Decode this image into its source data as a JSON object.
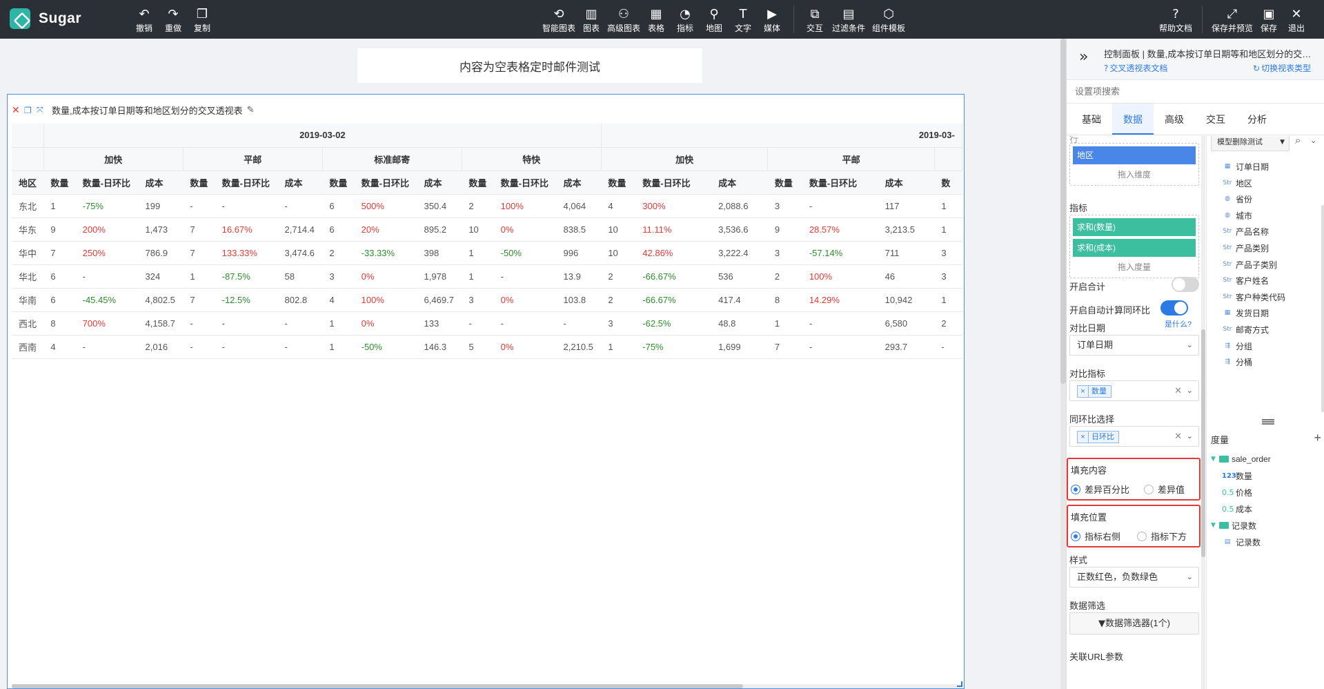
{
  "app": {
    "name": "Sugar"
  },
  "toolbar": {
    "left": [
      {
        "name": "undo",
        "icon": "undo-icon",
        "glyph": "↶",
        "label": "撤销"
      },
      {
        "name": "redo",
        "icon": "redo-icon",
        "glyph": "↷",
        "label": "重做"
      },
      {
        "name": "copy",
        "icon": "copy-icon",
        "glyph": "❐",
        "label": "复制"
      }
    ],
    "center": [
      {
        "name": "smart-chart",
        "icon": "smart-chart-icon",
        "glyph": "⟲",
        "label": "智能图表"
      },
      {
        "name": "chart",
        "icon": "bar-chart-icon",
        "glyph": "▥",
        "label": "图表"
      },
      {
        "name": "advanced-chart",
        "icon": "advanced-chart-icon",
        "glyph": "⚇",
        "label": "高级图表"
      },
      {
        "name": "table",
        "icon": "table-icon",
        "glyph": "▦",
        "label": "表格"
      },
      {
        "name": "metric",
        "icon": "gauge-icon",
        "glyph": "◔",
        "label": "指标"
      },
      {
        "name": "map",
        "icon": "map-pin-icon",
        "glyph": "⚲",
        "label": "地图"
      },
      {
        "name": "text",
        "icon": "text-icon",
        "glyph": "T",
        "label": "文字"
      },
      {
        "name": "media",
        "icon": "media-icon",
        "glyph": "▶",
        "label": "媒体"
      }
    ],
    "center2": [
      {
        "name": "interaction",
        "icon": "interaction-icon",
        "glyph": "⧉",
        "label": "交互"
      },
      {
        "name": "filter",
        "icon": "filter-icon",
        "glyph": "▤",
        "label": "过滤条件"
      },
      {
        "name": "component-template",
        "icon": "component-icon",
        "glyph": "⬡",
        "label": "组件模板"
      }
    ],
    "right": [
      {
        "name": "help-docs",
        "icon": "help-icon",
        "glyph": "?",
        "label": "帮助文档"
      },
      {
        "name": "save-preview",
        "icon": "expand-icon",
        "glyph": "⤢",
        "label": "保存并预览"
      },
      {
        "name": "save",
        "icon": "save-icon",
        "glyph": "▣",
        "label": "保存"
      },
      {
        "name": "exit",
        "icon": "close-icon",
        "glyph": "✕",
        "label": "退出"
      }
    ]
  },
  "canvas": {
    "title": "内容为空表格定时邮件测试",
    "widget_title": "数量,成本按订单日期等和地区划分的交叉透视表"
  },
  "pivot": {
    "dates": [
      "2019-03-02",
      "2019-03-"
    ],
    "ship_modes": [
      "加快",
      "平邮",
      "标准邮寄",
      "特快",
      "加快",
      "平邮"
    ],
    "row_header": "地区",
    "metric_headers": [
      "数量",
      "数量-日环比",
      "成本"
    ],
    "last_partial_header": "数",
    "rows": [
      {
        "region": "东北",
        "cells": [
          "1",
          "-75%",
          "199",
          "-",
          "-",
          "-",
          "6",
          "500%",
          "350.4",
          "2",
          "100%",
          "4,064",
          "4",
          "300%",
          "2,088.6",
          "3",
          "-",
          "117",
          "1"
        ]
      },
      {
        "region": "华东",
        "cells": [
          "9",
          "200%",
          "1,473",
          "7",
          "16.67%",
          "2,714.4",
          "6",
          "20%",
          "895.2",
          "10",
          "0%",
          "838.5",
          "10",
          "11.11%",
          "3,536.6",
          "9",
          "28.57%",
          "3,213.5",
          "1"
        ]
      },
      {
        "region": "华中",
        "cells": [
          "7",
          "250%",
          "786.9",
          "7",
          "133.33%",
          "3,474.6",
          "2",
          "-33.33%",
          "398",
          "1",
          "-50%",
          "996",
          "10",
          "42.86%",
          "3,222.4",
          "3",
          "-57.14%",
          "711",
          "3"
        ]
      },
      {
        "region": "华北",
        "cells": [
          "6",
          "-",
          "324",
          "1",
          "-87.5%",
          "58",
          "3",
          "0%",
          "1,978",
          "1",
          "-",
          "13.9",
          "2",
          "-66.67%",
          "536",
          "2",
          "100%",
          "46",
          "3"
        ]
      },
      {
        "region": "华南",
        "cells": [
          "6",
          "-45.45%",
          "4,802.5",
          "7",
          "-12.5%",
          "802.8",
          "4",
          "100%",
          "6,469.7",
          "3",
          "0%",
          "103.8",
          "2",
          "-66.67%",
          "417.4",
          "8",
          "14.29%",
          "10,942",
          "1"
        ]
      },
      {
        "region": "西北",
        "cells": [
          "8",
          "700%",
          "4,158.7",
          "-",
          "-",
          "-",
          "1",
          "0%",
          "133",
          "-",
          "-",
          "-",
          "3",
          "-62.5%",
          "48.8",
          "1",
          "-",
          "6,580",
          "2"
        ]
      },
      {
        "region": "西南",
        "cells": [
          "4",
          "-",
          "2,016",
          "-",
          "-",
          "-",
          "1",
          "-50%",
          "146.3",
          "5",
          "0%",
          "2,210.5",
          "1",
          "-75%",
          "1,699",
          "7",
          "-",
          "293.7",
          "-"
        ]
      }
    ]
  },
  "panel": {
    "title": "控制面板 | 数量,成本按订单日期等和地区划分的交叉透视表",
    "doc_link": "交叉透视表文档",
    "switch_link": "切换视表类型",
    "search_placeholder": "设置项搜索",
    "tabs": [
      {
        "label": "基础",
        "active": false
      },
      {
        "label": "数据",
        "active": true
      },
      {
        "label": "高级",
        "active": false
      },
      {
        "label": "交互",
        "active": false
      },
      {
        "label": "分析",
        "active": false
      }
    ],
    "cut_label": "行",
    "dimension_chip": "地区",
    "dimension_hint": "拖入维度",
    "metrics_label": "指标",
    "metric_chips": [
      "求和(数量)",
      "求和(成本)"
    ],
    "metric_hint": "拖入度量",
    "total_label": "开启合计",
    "auto_calc_label": "开启自动计算同环比",
    "what_link": "是什么?",
    "compare_date_label": "对比日期",
    "compare_date_value": "订单日期",
    "compare_metric_label": "对比指标",
    "compare_metric_tag": "数量",
    "yoy_label": "同环比选择",
    "yoy_tag": "日环比",
    "fill_content_label": "填充内容",
    "fill_content_options": [
      "差异百分比",
      "差异值"
    ],
    "fill_position_label": "填充位置",
    "fill_position_options": [
      "指标右侧",
      "指标下方"
    ],
    "style_label": "样式",
    "style_value": "正数红色，负数绿色",
    "data_filter_label": "数据筛选",
    "data_filter_button": "数据筛选器(1个)",
    "url_param_label": "关联URL参数"
  },
  "datasource": {
    "model": "模型删除测试",
    "dimensions": [
      {
        "name": "订单日期",
        "type": "date"
      },
      {
        "name": "地区",
        "type": "Str"
      },
      {
        "name": "省份",
        "type": "geo"
      },
      {
        "name": "城市",
        "type": "geo"
      },
      {
        "name": "产品名称",
        "type": "Str"
      },
      {
        "name": "产品类别",
        "type": "Str"
      },
      {
        "name": "产品子类别",
        "type": "Str"
      },
      {
        "name": "客户姓名",
        "type": "Str"
      },
      {
        "name": "客户种类代码",
        "type": "Str"
      },
      {
        "name": "发货日期",
        "type": "date"
      },
      {
        "name": "邮寄方式",
        "type": "Str"
      },
      {
        "name": "分组",
        "type": "group"
      },
      {
        "name": "分桶",
        "type": "group"
      }
    ],
    "measures_label": "度量",
    "measure_folder": "sale_order",
    "measures": [
      {
        "name": "数量",
        "type": "123"
      },
      {
        "name": "价格",
        "type": "0.5"
      },
      {
        "name": "成本",
        "type": "0.5"
      }
    ],
    "count_folder": "记录数",
    "count_field": "记录数"
  }
}
